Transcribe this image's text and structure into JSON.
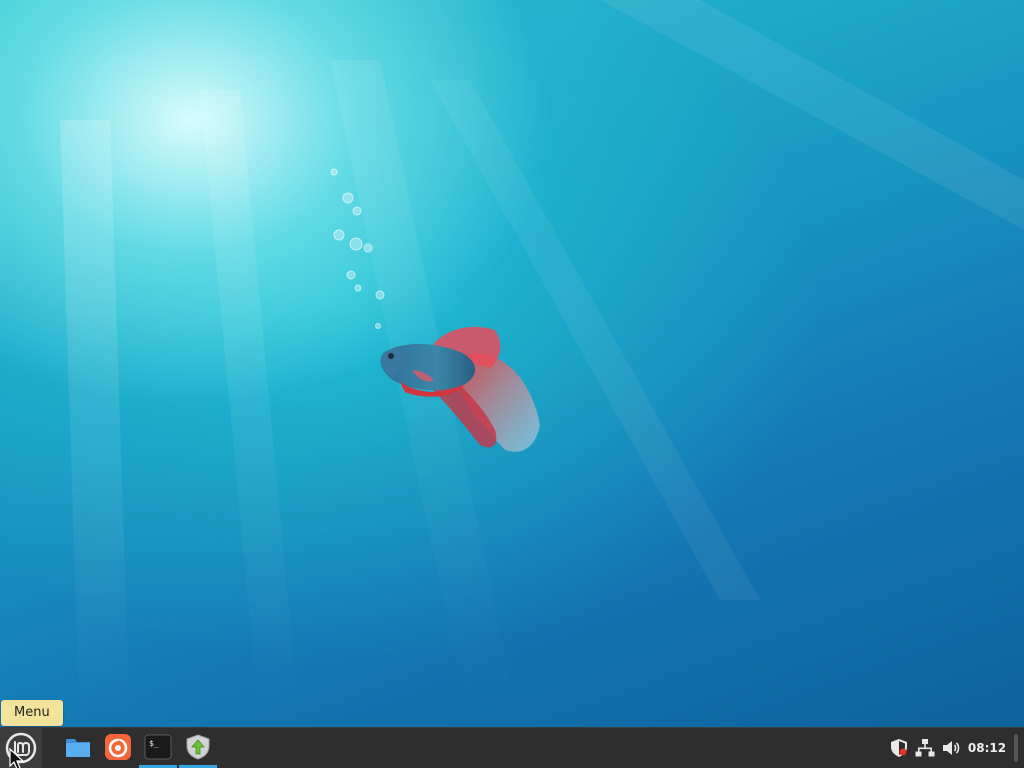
{
  "desktop": {
    "wallpaper": "betta-fish-underwater"
  },
  "tooltip": {
    "text": "Menu"
  },
  "taskbar": {
    "menu": {
      "icon": "linux-mint-logo-icon"
    },
    "launchers": [
      {
        "name": "files",
        "icon": "folder-icon",
        "running": false
      },
      {
        "name": "firefox",
        "icon": "firefox-icon",
        "running": false
      },
      {
        "name": "terminal",
        "icon": "terminal-icon",
        "label": "$_",
        "running": true
      },
      {
        "name": "update-manager",
        "icon": "shield-update-icon",
        "running": true
      }
    ],
    "tray": [
      {
        "name": "update-shield",
        "icon": "shield-alert-icon"
      },
      {
        "name": "network",
        "icon": "network-icon"
      },
      {
        "name": "volume",
        "icon": "volume-icon"
      }
    ],
    "clock": "08:12"
  },
  "colors": {
    "taskbar": "#2e2e2e",
    "running_indicator": "#35a7e0",
    "tooltip_bg": "#f3e39a",
    "firefox_orange": "#f4663a"
  }
}
